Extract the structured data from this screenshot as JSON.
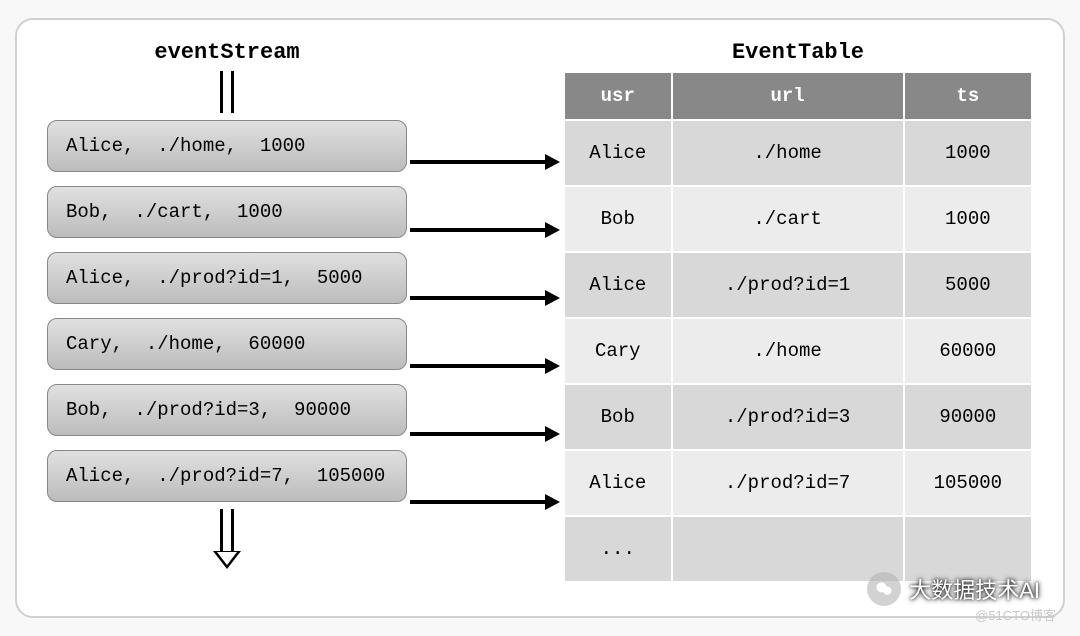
{
  "stream_title": "eventStream",
  "table_title": "EventTable",
  "events": [
    {
      "usr": "Alice",
      "url": "./home",
      "ts": "1000"
    },
    {
      "usr": "Bob",
      "url": "./cart",
      "ts": "1000"
    },
    {
      "usr": "Alice",
      "url": "./prod?id=1",
      "ts": "5000"
    },
    {
      "usr": "Cary",
      "url": "./home",
      "ts": "60000"
    },
    {
      "usr": "Bob",
      "url": "./prod?id=3",
      "ts": "90000"
    },
    {
      "usr": "Alice",
      "url": "./prod?id=7",
      "ts": "105000"
    }
  ],
  "stream_labels": [
    "Alice,  ./home,  1000",
    "Bob,  ./cart,  1000",
    "Alice,  ./prod?id=1,  5000",
    "Cary,  ./home,  60000",
    "Bob,  ./prod?id=3,  90000",
    "Alice,  ./prod?id=7,  105000"
  ],
  "columns": {
    "c1": "usr",
    "c2": "url",
    "c3": "ts"
  },
  "ellipsis": "...",
  "brand": "大数据技术AI",
  "watermark": "@51CTO博客"
}
